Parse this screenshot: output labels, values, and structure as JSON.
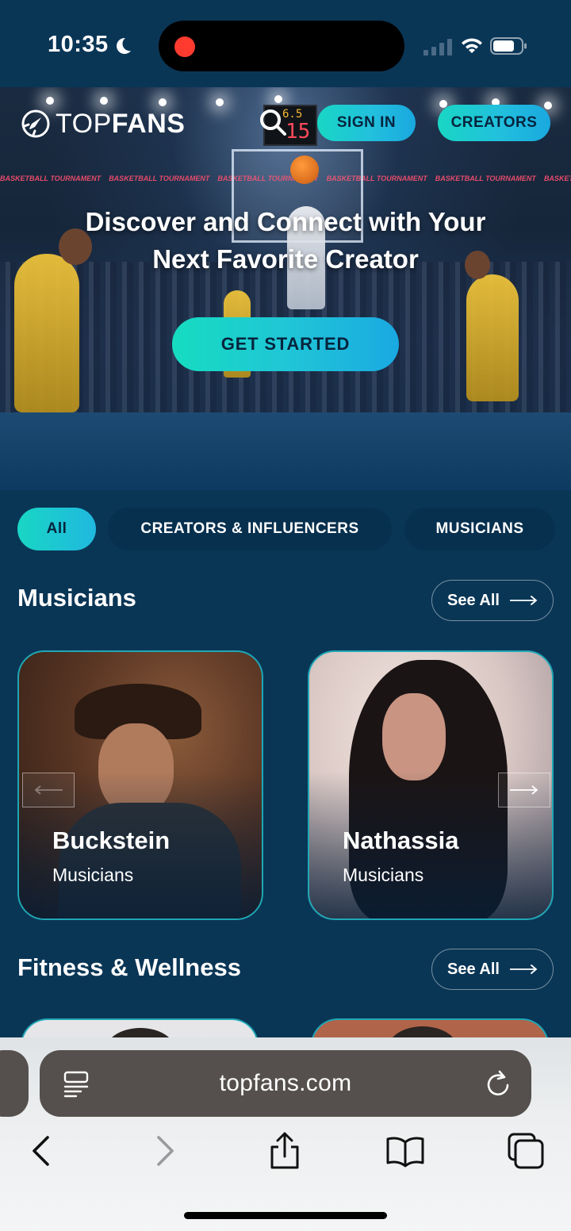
{
  "status_bar": {
    "time": "10:35"
  },
  "hero": {
    "brand_light": "TOP",
    "brand_bold": "FANS",
    "sign_in_label": "SIGN IN",
    "creators_label": "CREATORS",
    "headline_line1": "Discover and Connect with Your",
    "headline_line2": "Next Favorite Creator",
    "cta_label": "GET STARTED",
    "scoreboard_top": "6.5",
    "scoreboard_bottom": "15",
    "banner_text": "BASKETBALL TOURNAMENT"
  },
  "tabs": [
    {
      "label": "All",
      "active": true
    },
    {
      "label": "CREATORS & INFLUENCERS",
      "active": false
    },
    {
      "label": "MUSICIANS",
      "active": false
    }
  ],
  "sections": [
    {
      "title": "Musicians",
      "see_all_label": "See All",
      "cards": [
        {
          "name": "Buckstein",
          "category": "Musicians"
        },
        {
          "name": "Nathassia",
          "category": "Musicians"
        }
      ]
    },
    {
      "title": "Fitness & Wellness",
      "see_all_label": "See All"
    }
  ],
  "browser": {
    "url": "topfans.com",
    "icons": [
      "reader-icon",
      "reload-icon",
      "back-icon",
      "forward-icon",
      "share-icon",
      "bookmarks-icon",
      "tabs-icon"
    ]
  },
  "colors": {
    "background": "#0a3656",
    "accent_start": "#19d6c4",
    "accent_end": "#1aa8df",
    "card_border": "#1fa7b5"
  }
}
